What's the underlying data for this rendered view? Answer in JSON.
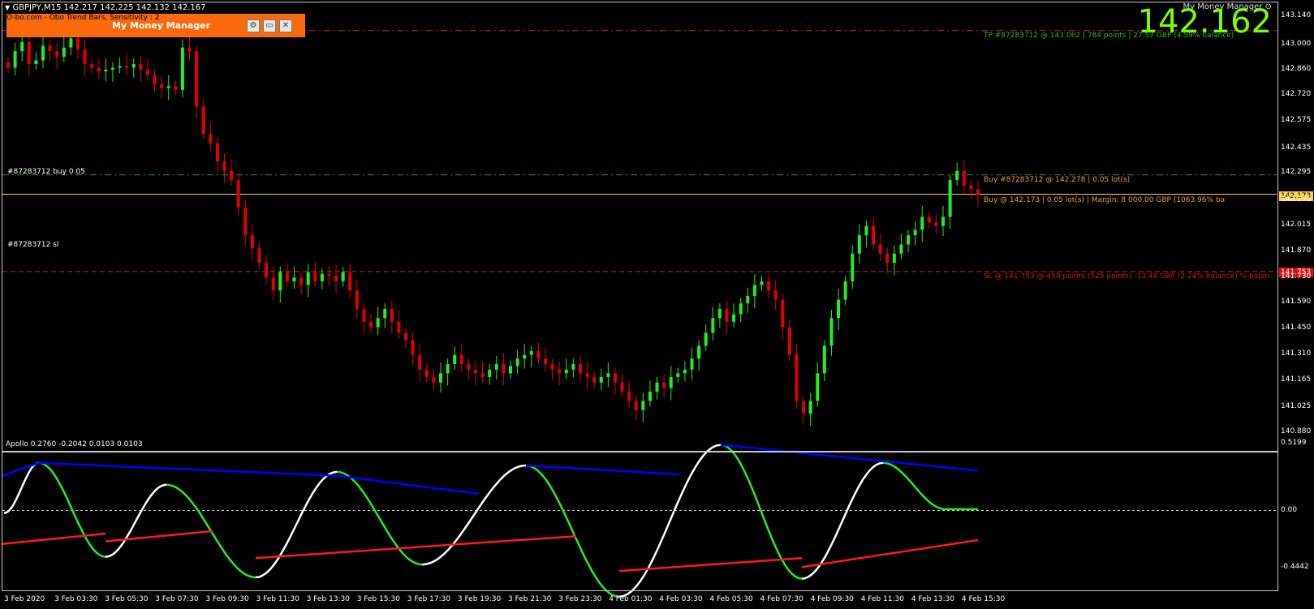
{
  "header": {
    "symbol_line": "GBPJPY,M15  142.217 142.225 142.132 142.167",
    "bid_big": "142.162",
    "mm_label": "My Money Manager"
  },
  "mm_panel": {
    "subtitle": "O-bo.com - Obo Trend Bars, Sensitivity : 2",
    "title": "My Money Manager",
    "btn_settings": "⚙",
    "btn_restore": "▭",
    "btn_close": "✕"
  },
  "trade_labels": {
    "buy_left": "#87283712 buy 0.05",
    "sl_left": "#87283712 sl",
    "tp_right": "TP #87283712 @ 143.062 | 784 points | 27.57 GBP (4.59% balance)",
    "buy_right": "Buy #87283712 @ 142.278 | 0.05 lot(s)",
    "margin_right": "Buy @ 142.173 | 0.05 lot(s) | Margin: 8 000.00 GBP (1063.96% ba",
    "sl_right": "SL @ 141.753 @ 450 points (525 points) -13.48 GBP (2.24% balance) % balan"
  },
  "price_boxes": {
    "bid": "142.173",
    "sl": "141.753"
  },
  "y_axis": [
    "143.140",
    "143.000",
    "142.860",
    "142.720",
    "142.575",
    "142.435",
    "142.295",
    "142.155",
    "142.015",
    "141.870",
    "141.730",
    "141.590",
    "141.450",
    "141.310",
    "141.165",
    "141.025",
    "140.880"
  ],
  "indicator": {
    "label": "Apollo 0.2760 -0.2042 0.0103 0.0103",
    "y_ticks": [
      "0.5199",
      "0.00",
      "-0.4442"
    ]
  },
  "x_axis": [
    "3 Feb 2020",
    "3 Feb 03:30",
    "3 Feb 05:30",
    "3 Feb 07:30",
    "3 Feb 09:30",
    "3 Feb 11:30",
    "3 Feb 13:30",
    "3 Feb 15:30",
    "3 Feb 17:30",
    "3 Feb 19:30",
    "3 Feb 21:30",
    "3 Feb 23:30",
    "4 Feb 01:30",
    "4 Feb 03:30",
    "4 Feb 05:30",
    "4 Feb 07:30",
    "4 Feb 09:30",
    "4 Feb 11:30",
    "4 Feb 13:30",
    "4 Feb 15:30"
  ],
  "colors": {
    "bull": "#22ee22",
    "bear": "#e00000",
    "bid_line": "#ffd24d",
    "tp_line": "#cc2222",
    "buy_line": "#2e8b57",
    "sl_line": "#cc2222",
    "ind_up": "#ffffff",
    "ind_down": "#22ee22",
    "upper_trend": "#0000ff",
    "lower_trend": "#ff1a1a",
    "mm_panel": "#f96a0f"
  },
  "chart_data": {
    "type": "candlestick",
    "symbol": "GBPJPY",
    "timeframe": "M15",
    "ohlc_last": {
      "open": 142.217,
      "high": 142.225,
      "low": 142.132,
      "close": 142.167
    },
    "bid": 142.162,
    "ylim": [
      140.88,
      143.14
    ],
    "levels": {
      "tp": 143.062,
      "buy": 142.278,
      "bid": 142.173,
      "sl": 141.753
    },
    "closes": [
      142.86,
      142.95,
      143.0,
      142.88,
      142.9,
      142.98,
      142.95,
      142.92,
      142.97,
      143.02,
      142.96,
      142.88,
      142.86,
      142.84,
      142.85,
      142.86,
      142.87,
      142.86,
      142.88,
      142.85,
      142.82,
      142.77,
      142.75,
      142.76,
      142.74,
      142.97,
      142.95,
      142.65,
      142.5,
      142.45,
      142.35,
      142.3,
      142.25,
      142.1,
      141.95,
      141.88,
      141.8,
      141.72,
      141.65,
      141.75,
      141.7,
      141.72,
      141.68,
      141.75,
      141.7,
      141.74,
      141.73,
      141.7,
      141.75,
      141.65,
      141.55,
      141.48,
      141.45,
      141.5,
      141.55,
      141.48,
      141.42,
      141.38,
      141.3,
      141.22,
      141.18,
      141.15,
      141.2,
      141.25,
      141.3,
      141.25,
      141.22,
      141.2,
      141.18,
      141.22,
      141.25,
      141.2,
      141.24,
      141.28,
      141.3,
      141.32,
      141.28,
      141.25,
      141.22,
      141.2,
      141.22,
      141.25,
      141.2,
      141.18,
      141.15,
      141.18,
      141.2,
      141.15,
      141.1,
      141.05,
      141.0,
      141.05,
      141.1,
      141.15,
      141.12,
      141.18,
      141.2,
      141.22,
      141.28,
      141.35,
      141.42,
      141.5,
      141.55,
      141.48,
      141.52,
      141.58,
      141.62,
      141.68,
      141.7,
      141.65,
      141.6,
      141.45,
      141.3,
      141.05,
      140.98,
      141.05,
      141.2,
      141.35,
      141.5,
      141.6,
      141.7,
      141.85,
      141.95,
      142.0,
      141.9,
      141.85,
      141.8,
      141.85,
      141.9,
      141.95,
      141.98,
      142.05,
      142.02,
      142.0,
      142.05,
      142.25,
      142.3,
      142.22,
      142.2,
      142.17
    ],
    "indicator": {
      "name": "Apollo",
      "values": [
        0.276,
        -0.2042,
        0.0103,
        0.0103
      ],
      "ylim": [
        -0.4442,
        0.5199
      ]
    }
  }
}
